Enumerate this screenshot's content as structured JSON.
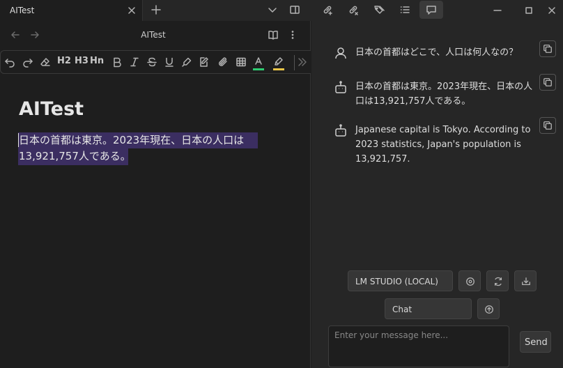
{
  "tab": {
    "title": "AITest"
  },
  "nav": {
    "title": "AITest"
  },
  "toolbar": {
    "h2": "H2",
    "h3": "H3",
    "hn": "Hn",
    "text_color": "#2ecc71"
  },
  "document": {
    "heading": "AITest",
    "paragraph": "日本の首都は東京。2023年現在、日本の人口は13,921,757人である。"
  },
  "chat": {
    "messages": [
      {
        "role": "user",
        "icon": "user-icon",
        "text": "日本の首都はどこで、人口は何人なの？"
      },
      {
        "role": "assistant",
        "icon": "bot-icon",
        "text": "日本の首都は東京。2023年現在、日本の人口は13,921,757人である。"
      },
      {
        "role": "assistant",
        "icon": "bot-icon",
        "text": "Japanese capital is Tokyo. According to 2023 statistics, Japan's population is 13,921,757."
      }
    ],
    "model_label": "LM STUDIO (LOCAL)",
    "mode_label": "Chat",
    "input_placeholder": "Enter your message here...",
    "send_label": "Send"
  },
  "colors": {
    "selection": "#3b2e61",
    "accent_text_color": "#2ecc71",
    "highlight": "#e8c547"
  }
}
